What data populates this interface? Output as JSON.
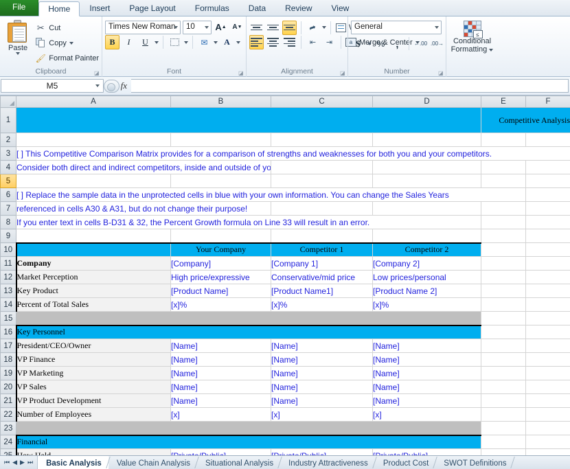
{
  "ribbon_tabs": [
    {
      "label": "File",
      "active": false,
      "file": true
    },
    {
      "label": "Home",
      "active": true
    },
    {
      "label": "Insert",
      "active": false
    },
    {
      "label": "Page Layout",
      "active": false
    },
    {
      "label": "Formulas",
      "active": false
    },
    {
      "label": "Data",
      "active": false
    },
    {
      "label": "Review",
      "active": false
    },
    {
      "label": "View",
      "active": false
    }
  ],
  "clipboard": {
    "group_title": "Clipboard",
    "paste_label": "Paste",
    "cut_label": "Cut",
    "copy_label": "Copy",
    "format_painter_label": "Format Painter"
  },
  "font": {
    "group_title": "Font",
    "font_name": "Times New Roman",
    "font_size": "10",
    "grow_label": "A",
    "shrink_label": "A",
    "bold_label": "B",
    "italic_label": "I",
    "underline_label": "U"
  },
  "alignment": {
    "group_title": "Alignment",
    "wrap_text_label": "Wrap Text",
    "merge_center_label": "Merge & Center"
  },
  "number": {
    "group_title": "Number",
    "format_value": "General",
    "currency_label": "$",
    "percent_label": "%",
    "comma_label": ",",
    "inc_dec_label": ".00",
    "dec_dec_label": ".00"
  },
  "styles": {
    "conditional_formatting_label": "Conditional\nFormatting",
    "cf_line1": "Conditional",
    "cf_line2": "Formatting"
  },
  "formula_bar": {
    "name_box": "M5",
    "formula_value": ""
  },
  "grid": {
    "columns": [
      "A",
      "B",
      "C",
      "D",
      "E",
      "F"
    ],
    "selected_row": "5",
    "rows": [
      {
        "n": "1",
        "type": "title",
        "a": "",
        "e": "Competitive Analysis"
      },
      {
        "n": "2",
        "type": "blank"
      },
      {
        "n": "3",
        "type": "note",
        "text": "[ ]  This Competitive Comparison Matrix provides for a comparison of strengths and weaknesses for both you and your competitors."
      },
      {
        "n": "4",
        "type": "note",
        "text": "Consider both direct and indirect competitors, inside and outside of your industry."
      },
      {
        "n": "5",
        "type": "blank"
      },
      {
        "n": "6",
        "type": "note",
        "text": "[ ]  Replace the sample data in the unprotected cells in blue with your own information.  You can change the Sales Years"
      },
      {
        "n": "7",
        "type": "note",
        "text": "referenced in cells A30 & A31, but do not change their purpose!"
      },
      {
        "n": "8",
        "type": "note",
        "text": "If you enter text in cells B-D31 & 32, the Percent Growth formula on Line 33 will result in an error."
      },
      {
        "n": "9",
        "type": "blank"
      },
      {
        "n": "10",
        "type": "header",
        "a": "",
        "b": "Your Company",
        "c": "Competitor 1",
        "d": "Competitor 2"
      },
      {
        "n": "11",
        "type": "data",
        "bold": true,
        "a": "Company",
        "b": "[Company]",
        "c": "[Company 1]",
        "d": "[Company 2]"
      },
      {
        "n": "12",
        "type": "data",
        "a": "Market Perception",
        "b": "High price/expressive",
        "c": "Conservative/mid price",
        "d": "Low prices/personal"
      },
      {
        "n": "13",
        "type": "data",
        "a": "Key Product",
        "b": "[Product Name]",
        "c": "[Product Name1]",
        "d": "[Product Name 2]"
      },
      {
        "n": "14",
        "type": "data",
        "a": "Percent of Total Sales",
        "b": "[x]%",
        "c": "[x]%",
        "d": "[x]%"
      },
      {
        "n": "15",
        "type": "spacer"
      },
      {
        "n": "16",
        "type": "section",
        "a": "Key Personnel"
      },
      {
        "n": "17",
        "type": "data",
        "a": "President/CEO/Owner",
        "b": "[Name]",
        "c": "[Name]",
        "d": "[Name]"
      },
      {
        "n": "18",
        "type": "data",
        "a": "VP Finance",
        "b": "[Name]",
        "c": "[Name]",
        "d": "[Name]"
      },
      {
        "n": "19",
        "type": "data",
        "a": "VP Marketing",
        "b": "[Name]",
        "c": "[Name]",
        "d": "[Name]"
      },
      {
        "n": "20",
        "type": "data",
        "a": "VP Sales",
        "b": "[Name]",
        "c": "[Name]",
        "d": "[Name]"
      },
      {
        "n": "21",
        "type": "data",
        "a": "VP Product Development",
        "b": "[Name]",
        "c": "[Name]",
        "d": "[Name]"
      },
      {
        "n": "22",
        "type": "data",
        "a": "Number of Employees",
        "b": "[x]",
        "c": "[x]",
        "d": "[x]"
      },
      {
        "n": "23",
        "type": "spacer"
      },
      {
        "n": "24",
        "type": "section",
        "a": "Financial"
      },
      {
        "n": "25",
        "type": "data",
        "a": "How Held",
        "b": "[Private/Public]",
        "c": "[Private/Public]",
        "d": "[Private/Public]"
      }
    ]
  },
  "sheet_tabs": [
    {
      "label": "Basic Analysis",
      "active": true
    },
    {
      "label": "Value Chain Analysis",
      "active": false
    },
    {
      "label": "Situational Analysis",
      "active": false
    },
    {
      "label": "Industry Attractiveness",
      "active": false
    },
    {
      "label": "Product Cost",
      "active": false
    },
    {
      "label": "SWOT Definitions",
      "active": false
    }
  ],
  "colors": {
    "accent_blue": "#00AEEF",
    "note_blue": "#2222DD",
    "gray_row": "#BFBFBF",
    "label_bg": "#F2F2F2"
  }
}
